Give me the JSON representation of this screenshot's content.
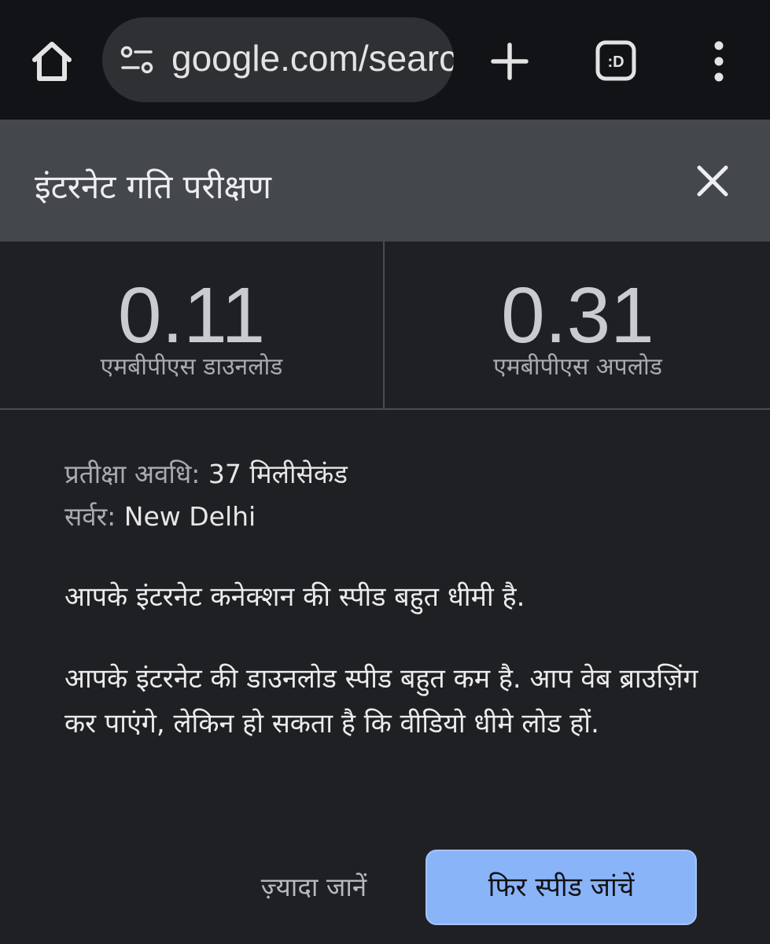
{
  "browser": {
    "url": "google.com/searc",
    "icons": [
      "home-icon",
      "tune-icon",
      "plus-icon",
      "tab-switcher-icon",
      "more-vert-icon"
    ],
    "tab_icon_text": ":D"
  },
  "panel": {
    "title": "इंटरनेट गति परीक्षण",
    "close_icon": "close-icon"
  },
  "stats": {
    "download": {
      "value": "0.11",
      "label": "एमबीपीएस डाउनलोड"
    },
    "upload": {
      "value": "0.31",
      "label": "एमबीपीएस अपलोड"
    }
  },
  "details": {
    "latency_label": "प्रतीक्षा अवधि:",
    "latency_value": "37 मिलीसेकंड",
    "server_label": "सर्वर:",
    "server_value": "New Delhi"
  },
  "messages": {
    "summary": "आपके इंटरनेट कनेक्शन की स्पीड बहुत धीमी है.",
    "detail": "आपके इंटरनेट की डाउनलोड स्पीड बहुत कम है. आप वेब ब्राउज़िंग कर पाएंगे, लेकिन हो सकता है कि वीडियो धीमे लोड हों."
  },
  "actions": {
    "learn_more": "ज़्यादा जानें",
    "retest": "फिर स्पीड जांचें"
  },
  "colors": {
    "topbar": "#121316",
    "urlbar": "#2f3033",
    "header": "#44474b",
    "panel": "#1f2023",
    "accent_button": "#8ab4f8"
  }
}
